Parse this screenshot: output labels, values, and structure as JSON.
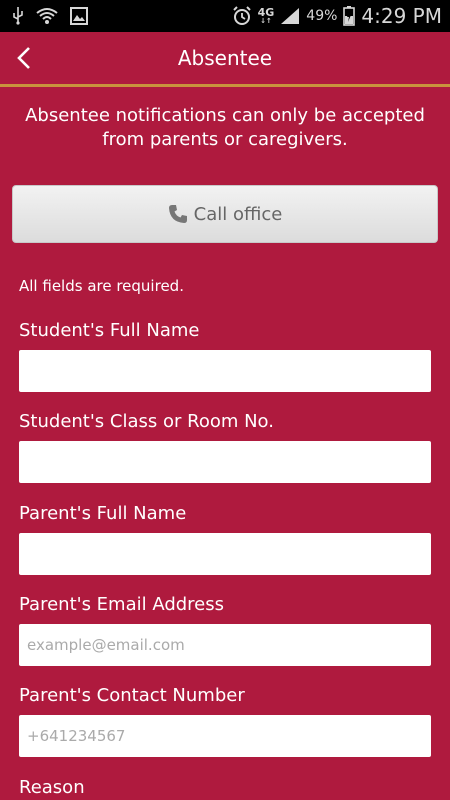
{
  "status_bar": {
    "network": "4G",
    "battery": "49%",
    "time": "4:29 PM"
  },
  "header": {
    "title": "Absentee"
  },
  "notice": "Absentee notifications can only be accepted from parents or caregivers.",
  "call_button": {
    "label": "Call office",
    "icon": "phone-icon"
  },
  "required_note": "All fields are required.",
  "fields": [
    {
      "label": "Student's Full Name",
      "placeholder": ""
    },
    {
      "label": "Student's Class or Room No.",
      "placeholder": ""
    },
    {
      "label": "Parent's Full Name",
      "placeholder": ""
    },
    {
      "label": "Parent's Email Address",
      "placeholder": "example@email.com"
    },
    {
      "label": "Parent's Contact Number",
      "placeholder": "+641234567"
    },
    {
      "label": "Reason"
    }
  ],
  "colors": {
    "background": "#af1a3e",
    "divider": "#c9933d"
  }
}
